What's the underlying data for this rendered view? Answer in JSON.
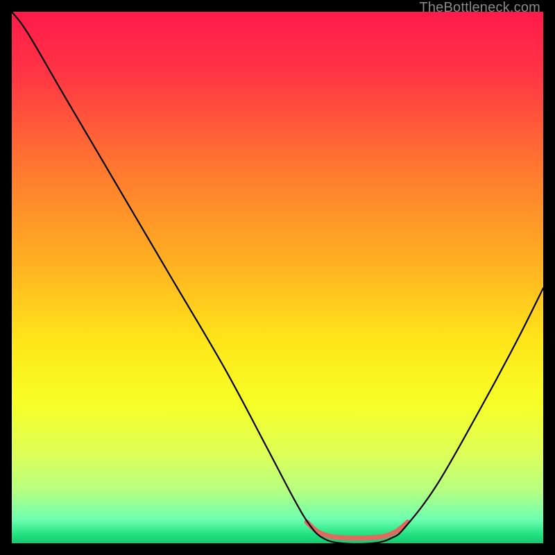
{
  "watermark": "TheBottleneck.com",
  "chart_data": {
    "type": "line",
    "title": "",
    "xlabel": "",
    "ylabel": "",
    "xlim": [
      0,
      100
    ],
    "ylim": [
      0,
      100
    ],
    "background_gradient": {
      "stops": [
        {
          "offset": 0.0,
          "color": "#ff1a4b"
        },
        {
          "offset": 0.12,
          "color": "#ff3644"
        },
        {
          "offset": 0.3,
          "color": "#ff7a2f"
        },
        {
          "offset": 0.48,
          "color": "#ffb321"
        },
        {
          "offset": 0.62,
          "color": "#ffe61a"
        },
        {
          "offset": 0.74,
          "color": "#f6ff28"
        },
        {
          "offset": 0.83,
          "color": "#deff57"
        },
        {
          "offset": 0.9,
          "color": "#b7ff80"
        },
        {
          "offset": 0.955,
          "color": "#6dffb0"
        },
        {
          "offset": 0.985,
          "color": "#1fe07f"
        },
        {
          "offset": 1.0,
          "color": "#17c86f"
        }
      ]
    },
    "series": [
      {
        "name": "bottleneck-curve",
        "stroke": "#000000",
        "stroke_width": 2.2,
        "points": [
          {
            "x": 0.0,
            "y": 100.0
          },
          {
            "x": 3.0,
            "y": 96.0
          },
          {
            "x": 10.0,
            "y": 84.0
          },
          {
            "x": 20.0,
            "y": 67.0
          },
          {
            "x": 30.0,
            "y": 50.0
          },
          {
            "x": 40.0,
            "y": 33.0
          },
          {
            "x": 48.0,
            "y": 18.0
          },
          {
            "x": 53.0,
            "y": 8.5
          },
          {
            "x": 56.0,
            "y": 3.5
          },
          {
            "x": 58.5,
            "y": 1.0
          },
          {
            "x": 62.0,
            "y": 0.0
          },
          {
            "x": 68.0,
            "y": 0.0
          },
          {
            "x": 71.5,
            "y": 1.0
          },
          {
            "x": 74.0,
            "y": 3.0
          },
          {
            "x": 80.0,
            "y": 11.0
          },
          {
            "x": 88.0,
            "y": 25.0
          },
          {
            "x": 95.0,
            "y": 38.0
          },
          {
            "x": 100.0,
            "y": 48.0
          }
        ]
      },
      {
        "name": "highlight-segment",
        "stroke": "#e06a5f",
        "stroke_width": 7,
        "points": [
          {
            "x": 55.5,
            "y": 4.0
          },
          {
            "x": 57.5,
            "y": 2.2
          },
          {
            "x": 60.0,
            "y": 1.3
          },
          {
            "x": 63.0,
            "y": 1.0
          },
          {
            "x": 67.0,
            "y": 1.0
          },
          {
            "x": 70.0,
            "y": 1.3
          },
          {
            "x": 72.5,
            "y": 2.3
          },
          {
            "x": 74.5,
            "y": 4.0
          }
        ]
      }
    ]
  }
}
